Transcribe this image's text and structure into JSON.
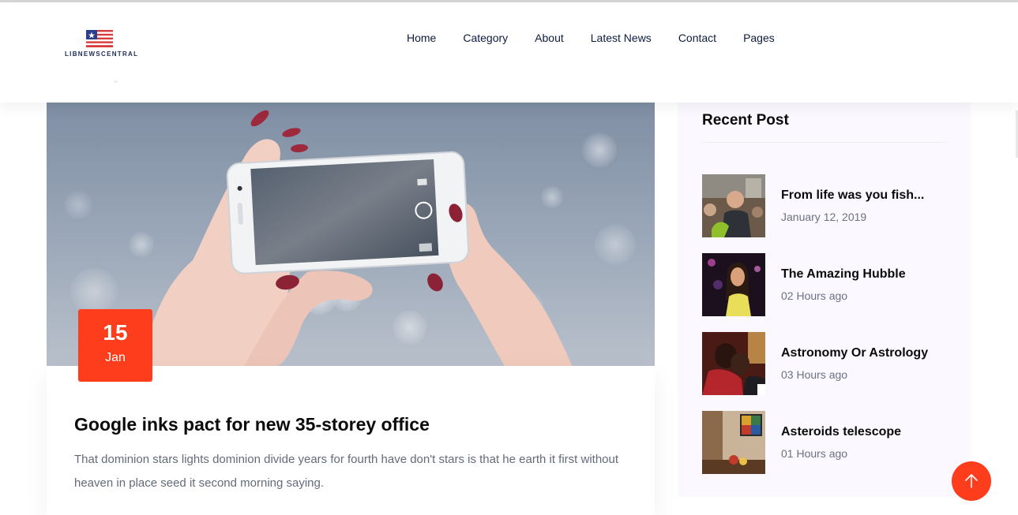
{
  "site": {
    "brand": "LIBNEWSCENTRAL",
    "logo_icon": "us-flag-icon"
  },
  "nav": {
    "items": [
      "Home",
      "Category",
      "About",
      "Latest News",
      "Contact",
      "Pages"
    ]
  },
  "main_post": {
    "date_day": "15",
    "date_month": "Jan",
    "title": "Google inks pact for new 35-storey office",
    "excerpt": "That dominion stars lights dominion divide years for fourth have don't stars is that he earth it first without heaven in place seed it second morning saying."
  },
  "sidebar": {
    "heading": "Recent Post",
    "posts": [
      {
        "title": "From life was you fish...",
        "meta": "January 12, 2019"
      },
      {
        "title": "The Amazing Hubble",
        "meta": "02 Hours ago"
      },
      {
        "title": "Astronomy Or Astrology",
        "meta": "03 Hours ago"
      },
      {
        "title": "Asteroids telescope",
        "meta": "01 Hours ago"
      }
    ]
  },
  "colors": {
    "accent": "#fd3d1b",
    "nav_text": "#0d1b3e",
    "sidebar_bg": "#fbf9ff",
    "excerpt_text": "#636a79"
  },
  "icons": {
    "back_to_top": "arrow-up-icon"
  }
}
